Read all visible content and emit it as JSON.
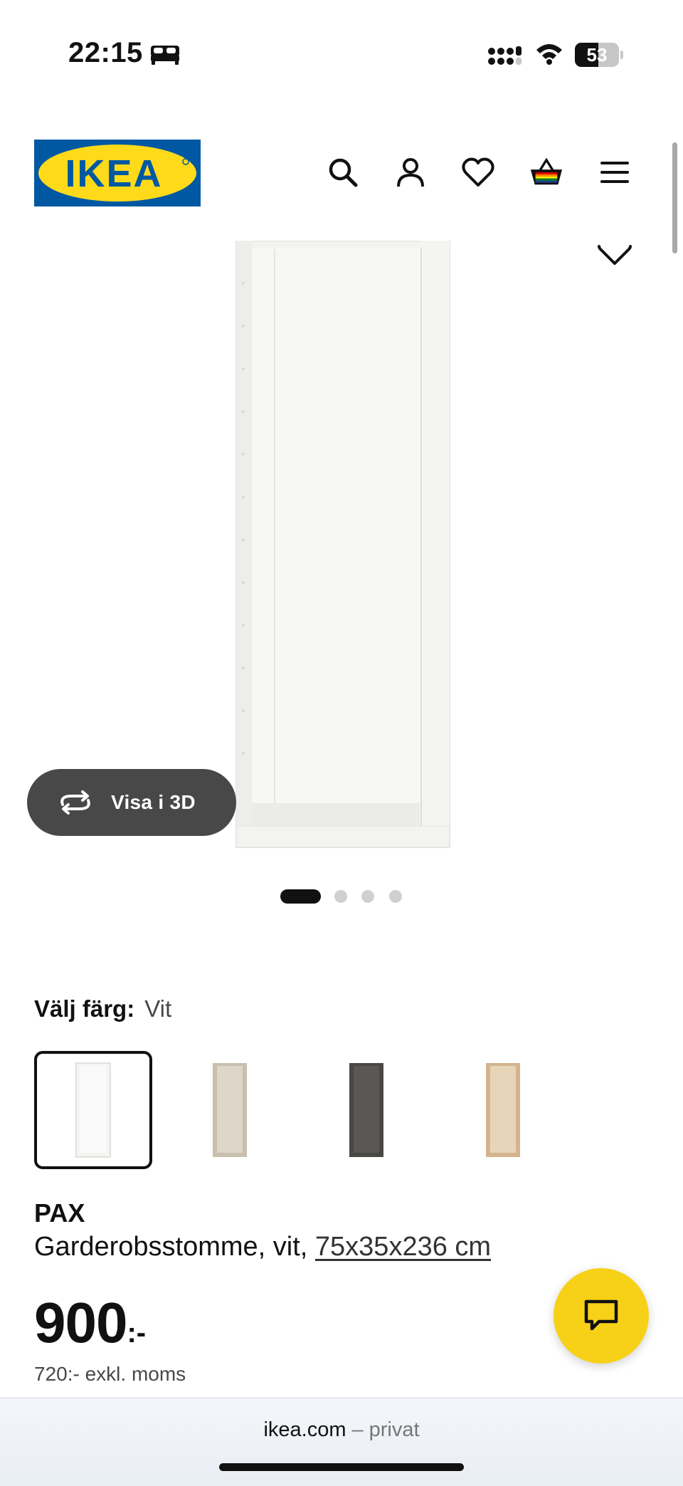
{
  "status_bar": {
    "time": "22:15",
    "battery_level": "53",
    "icons": [
      "bed-icon",
      "cellular-signal-icon",
      "wifi-icon",
      "battery-icon"
    ]
  },
  "header": {
    "logo_text": "IKEA",
    "icons": [
      "search-icon",
      "account-icon",
      "heart-icon",
      "basket-icon",
      "menu-icon"
    ],
    "brand_colors": {
      "blue": "#0058a3",
      "yellow": "#ffda1a"
    }
  },
  "gallery": {
    "view_3d_label": "Visa i 3D",
    "image_count": 4,
    "active_index": 0
  },
  "color_select": {
    "label": "Välj färg:",
    "selected_value": "Vit",
    "swatches": [
      {
        "color": "#f4f4f2",
        "selected": true
      },
      {
        "color": "#c9bfae",
        "selected": false
      },
      {
        "color": "#4a4845",
        "selected": false
      },
      {
        "color": "#ddc3a0",
        "selected": false
      }
    ]
  },
  "product": {
    "name": "PAX",
    "description": "Garderobsstomme, vit,",
    "size": "75x35x236 cm",
    "price": "900",
    "price_suffix": ":-",
    "price_excl_vat": "720:- exkl. moms"
  },
  "chat": {
    "accent": "#f7d117"
  },
  "browser": {
    "domain": "ikea.com",
    "separator": "–",
    "mode": "privat"
  }
}
